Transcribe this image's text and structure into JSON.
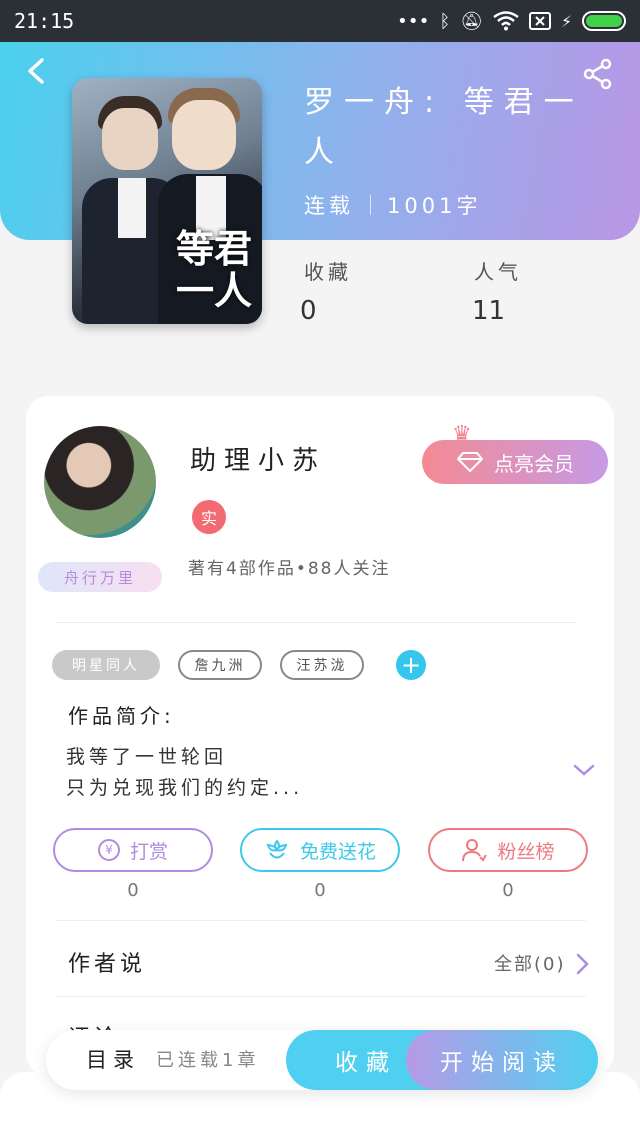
{
  "status_bar": {
    "time": "21:15",
    "icons": [
      "more-dots-icon",
      "bluetooth-icon",
      "mute-bell-icon",
      "wifi-icon",
      "sim-x-icon",
      "charging-icon",
      "battery-icon"
    ],
    "battery_level": 1.0
  },
  "header": {
    "book_title": "罗一舟: 等君一人",
    "status": "连载",
    "word_count": "1001字",
    "cover_text": "等君一人",
    "gradient": [
      "#4bd0ee",
      "#b996e6"
    ]
  },
  "stats": {
    "favorites_label": "收藏",
    "favorites_value": "0",
    "popularity_label": "人气",
    "popularity_value": "11"
  },
  "author": {
    "name": "助理小苏",
    "verified_badge": "实",
    "avatar_badge": "舟行万里",
    "summary": "著有4部作品•88人关注",
    "vip_button": "点亮会员"
  },
  "tags": [
    "明星同人",
    "詹九洲",
    "汪苏泷"
  ],
  "intro": {
    "label": "作品简介:",
    "line1": "我等了一世轮回",
    "line2": "只为兑现我们的约定..."
  },
  "actions": {
    "reward": {
      "label": "打赏",
      "count": "0",
      "color": "#b18be0"
    },
    "flowers": {
      "label": "免费送花",
      "count": "0",
      "color": "#3ec9ea"
    },
    "fans": {
      "label": "粉丝榜",
      "count": "0",
      "color": "#ee7a80"
    }
  },
  "author_say": {
    "label": "作者说",
    "all": "全部(0)"
  },
  "partial_row": "评论",
  "bottom": {
    "catalog": "目录",
    "catalog_status": "已连载1章",
    "collect": "收藏",
    "read": "开始阅读"
  }
}
